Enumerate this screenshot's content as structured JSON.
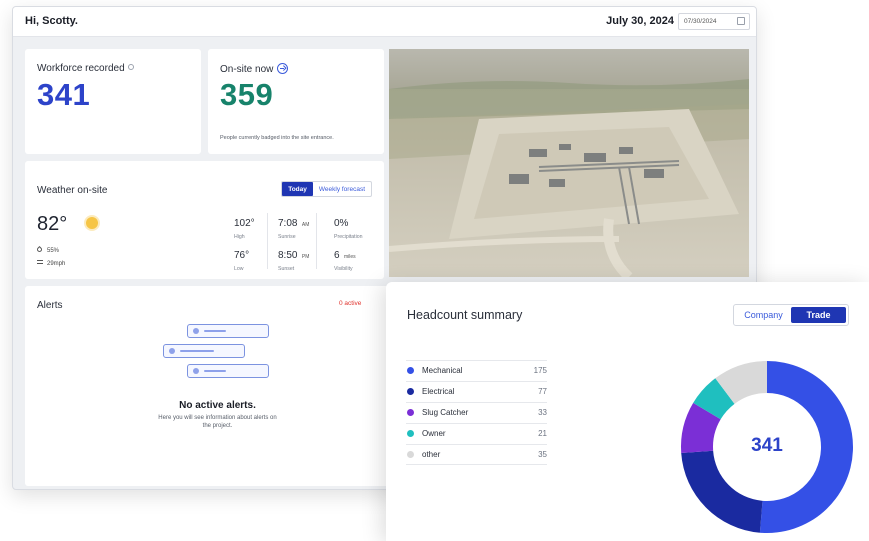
{
  "header": {
    "greeting": "Hi, Scotty.",
    "date_display": "July 30, 2024",
    "date_input_value": "07/30/2024"
  },
  "workforce": {
    "label": "Workforce recorded",
    "value": "341",
    "color": "#2d43c9"
  },
  "onsite": {
    "label": "On-site now",
    "value": "359",
    "note": "People currently badged into the site entrance.",
    "color": "#17836b"
  },
  "weather": {
    "title": "Weather on-site",
    "tabs": [
      {
        "label": "Today",
        "active": true
      },
      {
        "label": "Weekly forecast",
        "active": false
      }
    ],
    "temperature": "82°",
    "humidity": "55%",
    "wind": "29mph",
    "stats": [
      {
        "value": "102°",
        "unit": "",
        "label": "High"
      },
      {
        "value": "7:08",
        "unit": "AM",
        "label": "Sunrise"
      },
      {
        "value": "0%",
        "unit": "",
        "label": "Precipitation"
      },
      {
        "value": "76°",
        "unit": "",
        "label": "Low"
      },
      {
        "value": "8:50",
        "unit": "PM",
        "label": "Sunset"
      },
      {
        "value": "6",
        "unit": "miles",
        "label": "Visibility"
      }
    ]
  },
  "alerts": {
    "title": "Alerts",
    "count_label": "0 active",
    "empty_title": "No active alerts.",
    "empty_subtitle": "Here you will see information about alerts on the project."
  },
  "headcount": {
    "title": "Headcount summary",
    "toggle": [
      {
        "label": "Company",
        "active": false
      },
      {
        "label": "Trade",
        "active": true
      }
    ],
    "total": "341"
  },
  "chart_data": {
    "type": "pie",
    "categories": [
      "Mechanical",
      "Electrical",
      "Slug Catcher",
      "Owner",
      "other"
    ],
    "values": [
      175,
      77,
      33,
      21,
      35
    ],
    "colors": [
      "#3450e6",
      "#1a2aa0",
      "#7b2fd6",
      "#1fbfbf",
      "#d9d9d9"
    ],
    "center_label": "341",
    "legend": "left"
  }
}
